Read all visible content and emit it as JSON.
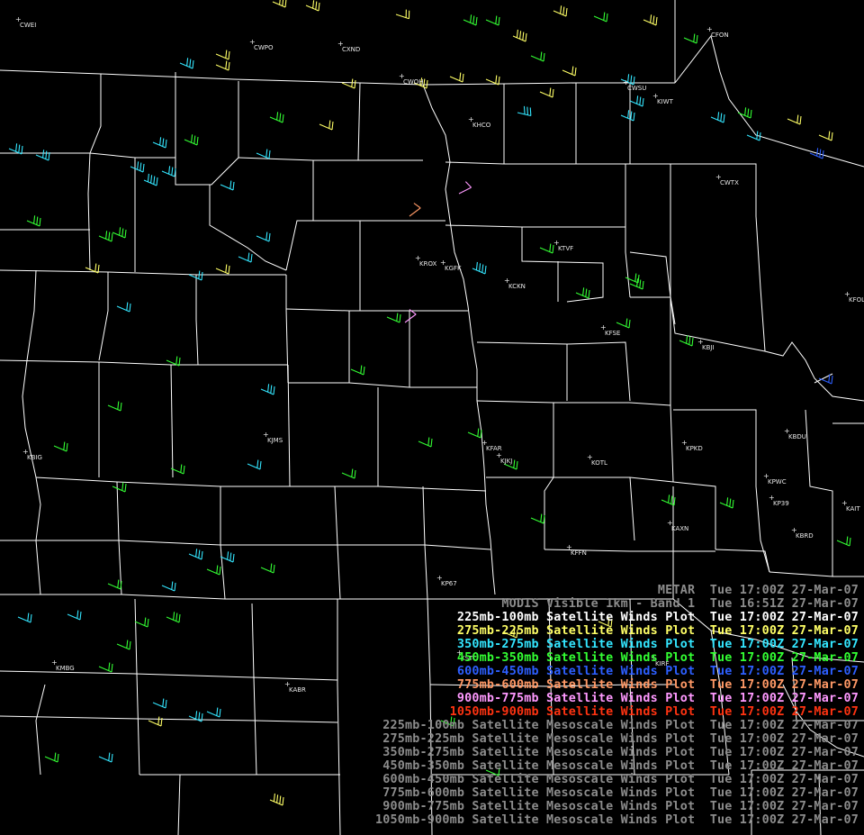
{
  "colors": {
    "background": "#000000",
    "borders": "#ffffff",
    "meso_gray": "#8c8c8c",
    "metar_gray": "#8c8c8c",
    "modis_gray": "#8c8c8c",
    "wind_225_100": "#ffffff",
    "wind_275_225": "#ffff66",
    "wind_350_275": "#33e6ff",
    "wind_450_350": "#33ff33",
    "wind_600_450": "#2d5fff",
    "wind_775_600": "#ff9966",
    "wind_900_775": "#ff99ff",
    "wind_1050_900": "#ff3311"
  },
  "stations": [
    "CWEI",
    "CWPO",
    "CXND",
    "CWOH",
    "CWSU",
    "KIWT",
    "CFON",
    "KHCO",
    "CWTX",
    "KROX",
    "KGFK",
    "KTVF",
    "KCKN",
    "KBJI",
    "KFSE",
    "KFOL",
    "KJMS",
    "KBIG",
    "KJKJ",
    "KFAR",
    "KOTL",
    "KPKD",
    "KAIT",
    "KBRD",
    "KPWC",
    "KP39",
    "KAXN",
    "KFFN",
    "KP67",
    "KABR",
    "KMBG",
    "KSTC",
    "KIRF",
    "KBDU"
  ],
  "legend": [
    {
      "text": "METAR  Tue 17:00Z 27-Mar-07",
      "color": "#8c8c8c"
    },
    {
      "text": "MODIS Visible 1km - Band 1  Tue 16:51Z 27-Mar-07",
      "color": "#8c8c8c"
    },
    {
      "text": "225mb-100mb Satellite Winds Plot  Tue 17:00Z 27-Mar-07",
      "color": "#ffffff"
    },
    {
      "text": "275mb-225mb Satellite Winds Plot  Tue 17:00Z 27-Mar-07",
      "color": "#ffff66"
    },
    {
      "text": "350mb-275mb Satellite Winds Plot  Tue 17:00Z 27-Mar-07",
      "color": "#33e6ff"
    },
    {
      "text": "450mb-350mb Satellite Winds Plot  Tue 17:00Z 27-Mar-07",
      "color": "#33ff33"
    },
    {
      "text": "600mb-450mb Satellite Winds Plot  Tue 17:00Z 27-Mar-07",
      "color": "#2d5fff"
    },
    {
      "text": "775mb-600mb Satellite Winds Plot  Tue 17:00Z 27-Mar-07",
      "color": "#ff9966"
    },
    {
      "text": "900mb-775mb Satellite Winds Plot  Tue 17:00Z 27-Mar-07",
      "color": "#ff99ff"
    },
    {
      "text": "1050mb-900mb Satellite Winds Plot  Tue 17:00Z 27-Mar-07",
      "color": "#ff3311"
    },
    {
      "text": "225mb-100mb Satellite Mesoscale Winds Plot  Tue 17:00Z 27-Mar-07",
      "color": "#8c8c8c"
    },
    {
      "text": "275mb-225mb Satellite Mesoscale Winds Plot  Tue 17:00Z 27-Mar-07",
      "color": "#8c8c8c"
    },
    {
      "text": "350mb-275mb Satellite Mesoscale Winds Plot  Tue 17:00Z 27-Mar-07",
      "color": "#8c8c8c"
    },
    {
      "text": "450mb-350mb Satellite Mesoscale Winds Plot  Tue 17:00Z 27-Mar-07",
      "color": "#8c8c8c"
    },
    {
      "text": "600mb-450mb Satellite Mesoscale Winds Plot  Tue 17:00Z 27-Mar-07",
      "color": "#8c8c8c"
    },
    {
      "text": "775mb-600mb Satellite Mesoscale Winds Plot  Tue 17:00Z 27-Mar-07",
      "color": "#8c8c8c"
    },
    {
      "text": "900mb-775mb Satellite Mesoscale Winds Plot  Tue 17:00Z 27-Mar-07",
      "color": "#8c8c8c"
    },
    {
      "text": "1050mb-900mb Satellite Mesoscale Winds Plot  Tue 17:00Z 27-Mar-07",
      "color": "#8c8c8c"
    }
  ]
}
